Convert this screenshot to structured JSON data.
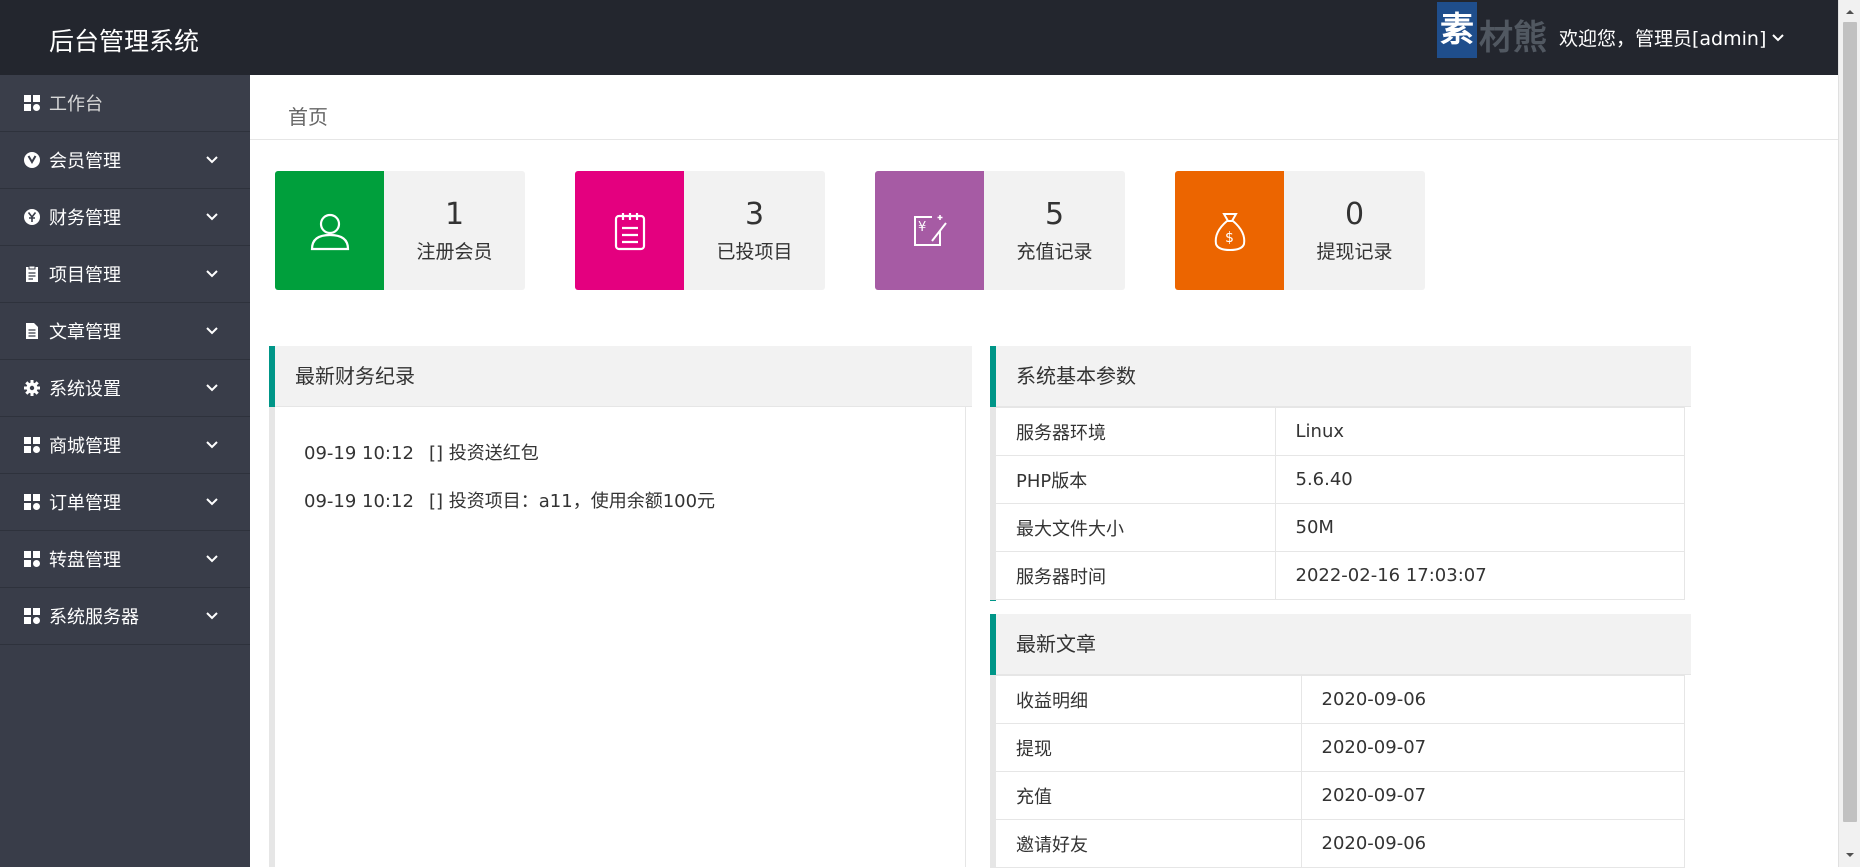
{
  "header": {
    "app_title": "后台管理系统",
    "watermark_text": "素材熊",
    "watermark_url": "sucai.com",
    "user_menu": "欢迎您，管理员[admin]"
  },
  "sidebar": {
    "items": [
      {
        "label": "工作台",
        "icon": "dashboard-icon"
      },
      {
        "label": "会员管理",
        "icon": "member-icon"
      },
      {
        "label": "财务管理",
        "icon": "finance-icon"
      },
      {
        "label": "项目管理",
        "icon": "clipboard-icon"
      },
      {
        "label": "文章管理",
        "icon": "document-icon"
      },
      {
        "label": "系统设置",
        "icon": "gear-icon"
      },
      {
        "label": "商城管理",
        "icon": "grid-icon"
      },
      {
        "label": "订单管理",
        "icon": "grid-icon"
      },
      {
        "label": "转盘管理",
        "icon": "grid-icon"
      },
      {
        "label": "系统服务器",
        "icon": "grid-icon"
      }
    ]
  },
  "breadcrumb": "首页",
  "stats": [
    {
      "value": "1",
      "label": "注册会员",
      "color": "#009f3c",
      "icon": "user-icon"
    },
    {
      "value": "3",
      "label": "已投项目",
      "color": "#e4007f",
      "icon": "notepad-icon"
    },
    {
      "value": "5",
      "label": "充值记录",
      "color": "#a65ba4",
      "icon": "recharge-icon"
    },
    {
      "value": "0",
      "label": "提现记录",
      "color": "#ec6500",
      "icon": "money-bag-icon"
    }
  ],
  "finance_panel": {
    "title": "最新财务纪录",
    "rows": [
      {
        "time": "09-19 10:12",
        "text": "[] 投资送红包"
      },
      {
        "time": "09-19 10:12",
        "text": "[] 投资项目：a11，使用余额100元"
      }
    ]
  },
  "system_panel": {
    "title": "系统基本参数",
    "rows": [
      {
        "key": "服务器环境",
        "value": "Linux"
      },
      {
        "key": "PHP版本",
        "value": "5.6.40"
      },
      {
        "key": "最大文件大小",
        "value": "50M"
      },
      {
        "key": "服务器时间",
        "value": "2022-02-16 17:03:07"
      }
    ]
  },
  "article_panel": {
    "title": "最新文章",
    "rows": [
      {
        "title": "收益明细",
        "date": "2020-09-06"
      },
      {
        "title": "提现",
        "date": "2020-09-07"
      },
      {
        "title": "充值",
        "date": "2020-09-07"
      },
      {
        "title": "邀请好友",
        "date": "2020-09-06"
      }
    ]
  },
  "colors": {
    "header_bg": "#23262e",
    "sidebar_bg": "#393d49",
    "panel_accent": "#009688"
  }
}
